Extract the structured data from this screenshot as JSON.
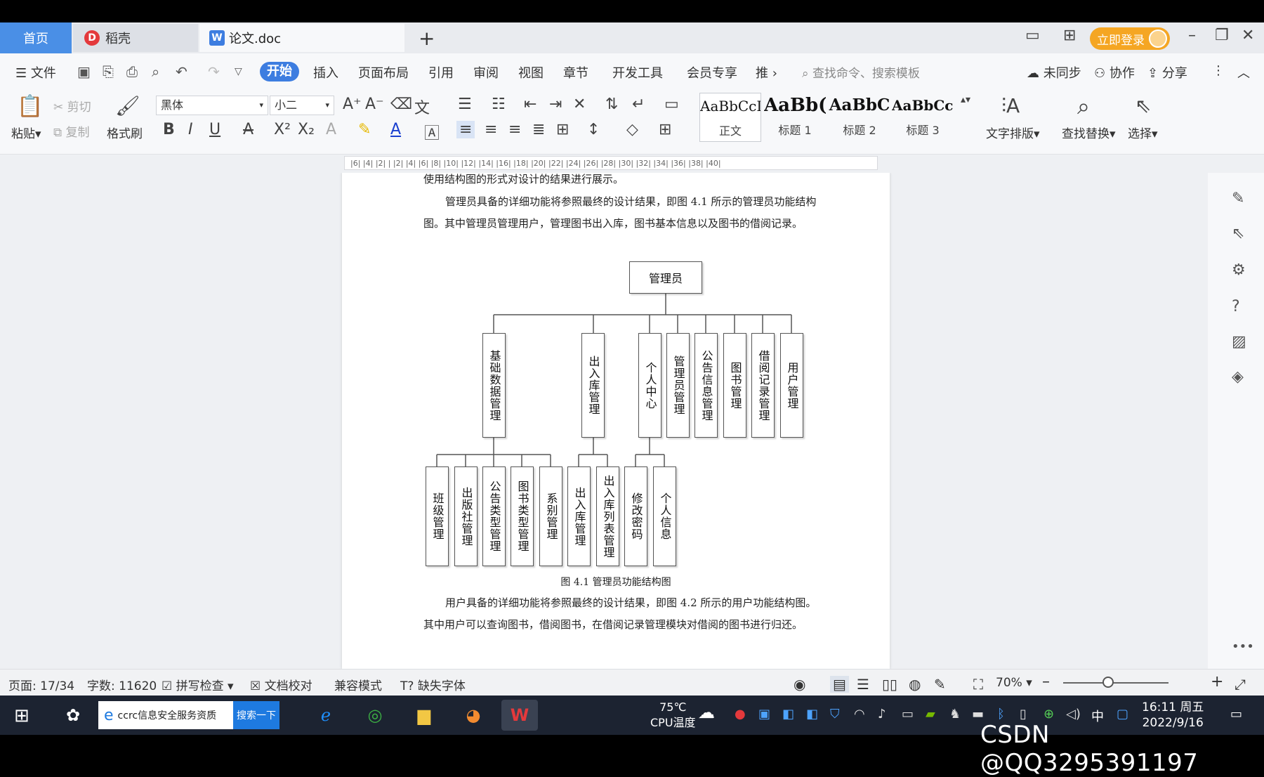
{
  "tabs": {
    "home": "首页",
    "docer": "稻壳",
    "doc": "论文.doc"
  },
  "header": {
    "login": "立即登录"
  },
  "menu": {
    "file": "文件",
    "items": [
      "开始",
      "插入",
      "页面布局",
      "引用",
      "审阅",
      "视图",
      "章节",
      "开发工具",
      "会员专享",
      "推"
    ],
    "search_placeholder": "查找命令、搜索模板",
    "sync": "未同步",
    "collab": "协作",
    "share": "分享"
  },
  "toolbar": {
    "paste": "粘贴",
    "cut": "剪切",
    "copy": "复制",
    "format_painter": "格式刷",
    "font_name": "黑体",
    "font_size": "小二",
    "styles": [
      {
        "sample": "AaBbCcI",
        "name": "正文"
      },
      {
        "sample": "AaBb(",
        "name": "标题 1"
      },
      {
        "sample": "AaBbC",
        "name": "标题 2"
      },
      {
        "sample": "AaBbCcl",
        "name": "标题 3"
      }
    ],
    "text_layout": "文字排版",
    "find_replace": "查找替换",
    "select": "选择"
  },
  "ruler": {
    "ticks": "|6|  |4|  |2|  |  |2|  |4|  |6|  |8|  |10|  |12|  |14|  |16|  |18|  |20|  |22|  |24|  |26|  |28|  |30|  |32|  |34|  |36|  |38|  |40|"
  },
  "document": {
    "line_top": "使用结构图的形式对设计的结果进行展示。",
    "para1": "管理员具备的详细功能将参照最终的设计结果，即图 4.1 所示的管理员功能结构图。其中管理员管理用户，管理图书出入库，图书基本信息以及图书的借阅记录。",
    "caption": "图 4.1 管理员功能结构图",
    "para2": "用户具备的详细功能将参照最终的设计结果，即图 4.2 所示的用户功能结构图。其中用户可以查询图书，借阅图书，在借阅记录管理模块对借阅的图书进行归还。"
  },
  "diagram": {
    "root": "管理员",
    "level1": [
      "基础数据管理",
      "出入库管理",
      "个人中心",
      "管理员管理",
      "公告信息管理",
      "图书管理",
      "借阅记录管理",
      "用户管理"
    ],
    "level2_base": [
      "班级管理",
      "出版社管理",
      "公告类型管理",
      "图书类型管理",
      "系别管理"
    ],
    "level2_inout": [
      "出入库管理",
      "出入库列表管理"
    ],
    "level2_personal": [
      "修改密码",
      "个人信息"
    ]
  },
  "status": {
    "page": "页面: 17/34",
    "words": "字数: 11620",
    "spell": "拼写检查",
    "proof": "文档校对",
    "compat": "兼容模式",
    "missing_font": "缺失字体",
    "zoom": "70%"
  },
  "taskbar": {
    "search_text": "ccrc信息安全服务资质",
    "search_btn": "搜索一下",
    "temp": "75℃",
    "temp_label": "CPU温度",
    "ime": "中",
    "time": "16:11 周五",
    "date": "2022/9/16"
  },
  "watermark": "CSDN @QQ3295391197",
  "colors": {
    "accent": "#3d7de0",
    "login": "#f5a623",
    "taskbar": "#1c2331"
  }
}
